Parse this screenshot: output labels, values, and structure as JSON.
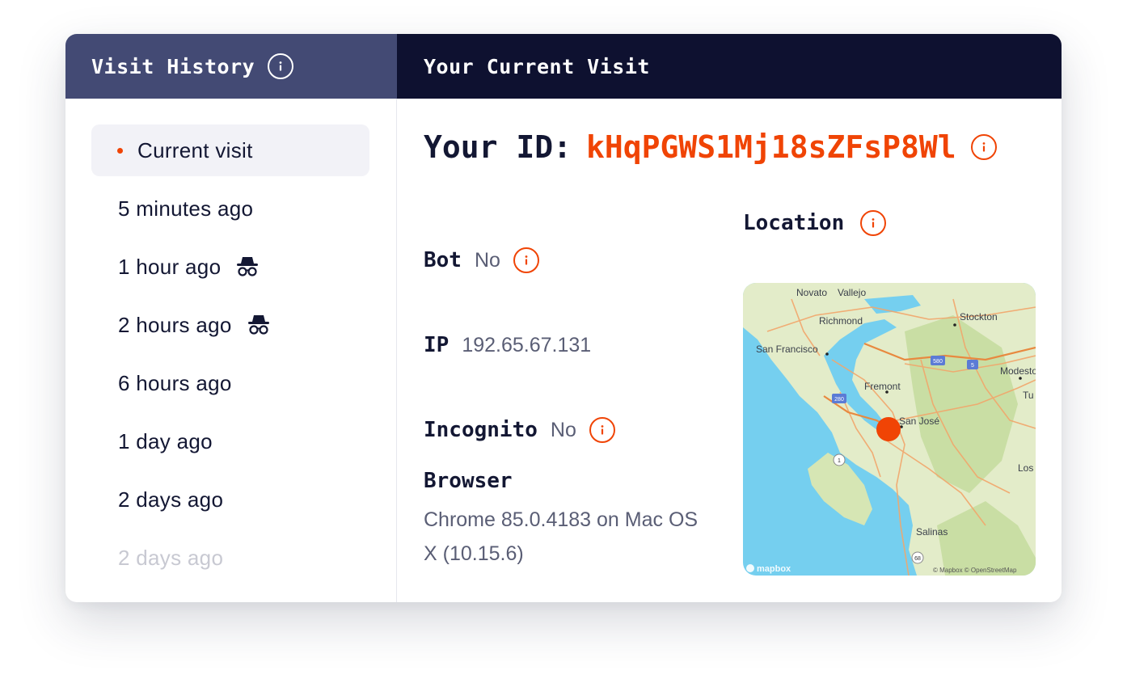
{
  "colors": {
    "accent": "#f04405",
    "header_left_bg": "#434a74",
    "header_right_bg": "#0e1130",
    "text_primary": "#131733",
    "text_secondary": "#5a5e75"
  },
  "history": {
    "title": "Visit History",
    "info_icon": "info-icon",
    "items": [
      {
        "label": "Current visit",
        "current": true,
        "incognito": false
      },
      {
        "label": "5 minutes ago",
        "current": false,
        "incognito": false
      },
      {
        "label": "1 hour ago",
        "current": false,
        "incognito": true
      },
      {
        "label": "2 hours ago",
        "current": false,
        "incognito": true
      },
      {
        "label": "6 hours ago",
        "current": false,
        "incognito": false
      },
      {
        "label": "1 day ago",
        "current": false,
        "incognito": false
      },
      {
        "label": "2 days ago",
        "current": false,
        "incognito": false
      },
      {
        "label": "2 days ago",
        "current": false,
        "incognito": false
      }
    ]
  },
  "current": {
    "title": "Your Current Visit",
    "id_label": "Your ID:",
    "id_value": "kHqPGWS1Mj18sZFsP8Wl",
    "bot": {
      "label": "Bot",
      "value": "No"
    },
    "ip": {
      "label": "IP",
      "value": "192.65.67.131"
    },
    "incognito": {
      "label": "Incognito",
      "value": "No"
    },
    "browser": {
      "label": "Browser",
      "value": "Chrome 85.0.4183 on Mac OS X (10.15.6)"
    },
    "location": {
      "label": "Location",
      "map": {
        "places": [
          "Novato",
          "Vallejo",
          "Richmond",
          "Stockton",
          "San Francisco",
          "Modesto",
          "Tu",
          "Fremont",
          "San José",
          "Los",
          "Salinas"
        ],
        "highway_shields": [
          "580",
          "5",
          "280",
          "1",
          "68"
        ],
        "logo": "mapbox",
        "attribution": "© Mapbox © OpenStreetMap"
      }
    }
  }
}
